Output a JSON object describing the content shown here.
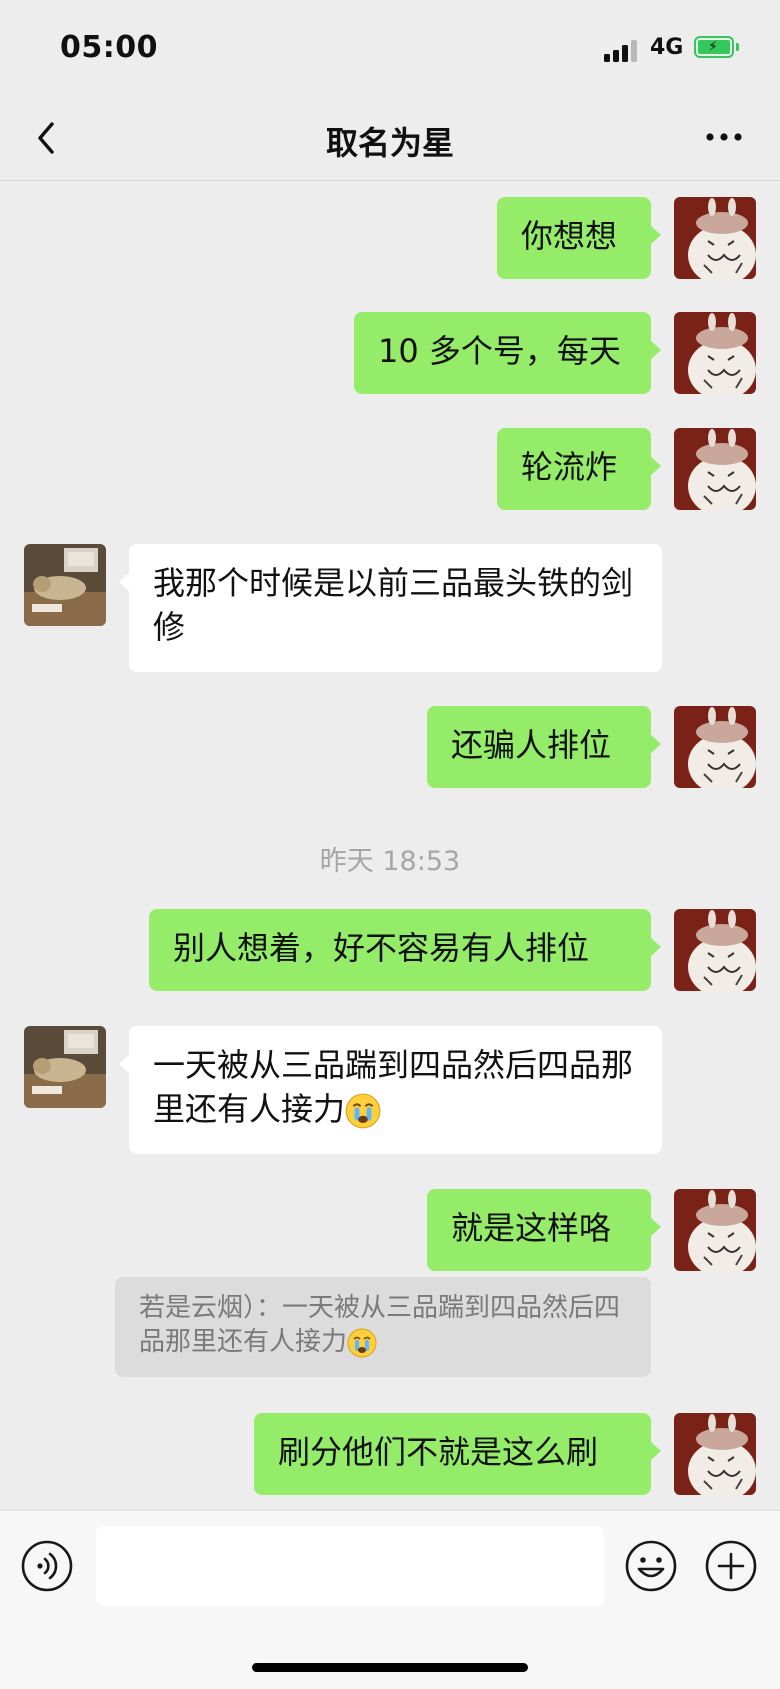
{
  "status_bar": {
    "time": "05:00",
    "network": "4G",
    "battery_icon": "battery-charging-icon",
    "signal_icon": "cellular-signal-icon"
  },
  "header": {
    "title": "取名为星",
    "back_icon": "back-chevron-icon",
    "more_icon": "more-dots-icon"
  },
  "messages": [
    {
      "side": "out",
      "text": "你想想"
    },
    {
      "side": "out",
      "text": "10 多个号，每天"
    },
    {
      "side": "out",
      "text": "轮流炸"
    },
    {
      "side": "in",
      "text": "我那个时候是以前三品最头铁的剑修"
    },
    {
      "side": "out",
      "text": "还骗人排位"
    },
    {
      "timestamp": "昨天 18:53"
    },
    {
      "side": "out",
      "text": "别人想着，好不容易有人排位"
    },
    {
      "side": "in",
      "text": "一天被从三品踹到四品然后四品那里还有人接力",
      "emoji": "crying-face-emoji"
    },
    {
      "side": "out",
      "text": "就是这样咯"
    },
    {
      "quote": "若是云烟）：一天被从三品踹到四品然后四品那里还有人接力",
      "emoji": "crying-face-emoji"
    },
    {
      "side": "out",
      "text": "刷分他们不就是这么刷"
    }
  ],
  "input_bar": {
    "voice_icon": "voice-input-icon",
    "emoji_icon": "emoji-icon",
    "plus_icon": "plus-icon",
    "input_value": ""
  },
  "colors": {
    "background": "#ededed",
    "outgoing_bubble": "#95ec69",
    "incoming_bubble": "#ffffff",
    "quote_bg": "#dcdcdc"
  }
}
